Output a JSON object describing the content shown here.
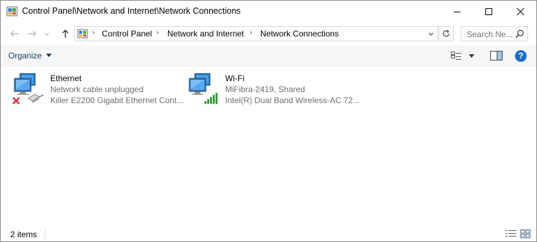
{
  "window": {
    "title": "Control Panel\\Network and Internet\\Network Connections"
  },
  "address": {
    "crumbs": [
      "Control Panel",
      "Network and Internet",
      "Network Connections"
    ]
  },
  "search": {
    "placeholder": "Search Ne..."
  },
  "toolbar": {
    "organize_label": "Organize",
    "help_label": "?"
  },
  "connections": [
    {
      "name": "Ethernet",
      "status": "Network cable unplugged",
      "device": "Killer E2200 Gigabit Ethernet Cont...",
      "icon": "ethernet-disconnected-icon"
    },
    {
      "name": "Wi-Fi",
      "status": "MiFibra-2419, Shared",
      "device": "Intel(R) Dual Band Wireless-AC 72...",
      "icon": "wifi-connected-icon"
    }
  ],
  "statusbar": {
    "item_count": "2 items"
  },
  "colors": {
    "accent": "#1a6fc5",
    "error": "#d32f2f",
    "signal": "#3a9e3a",
    "command_bar": "#f5f6f7"
  }
}
